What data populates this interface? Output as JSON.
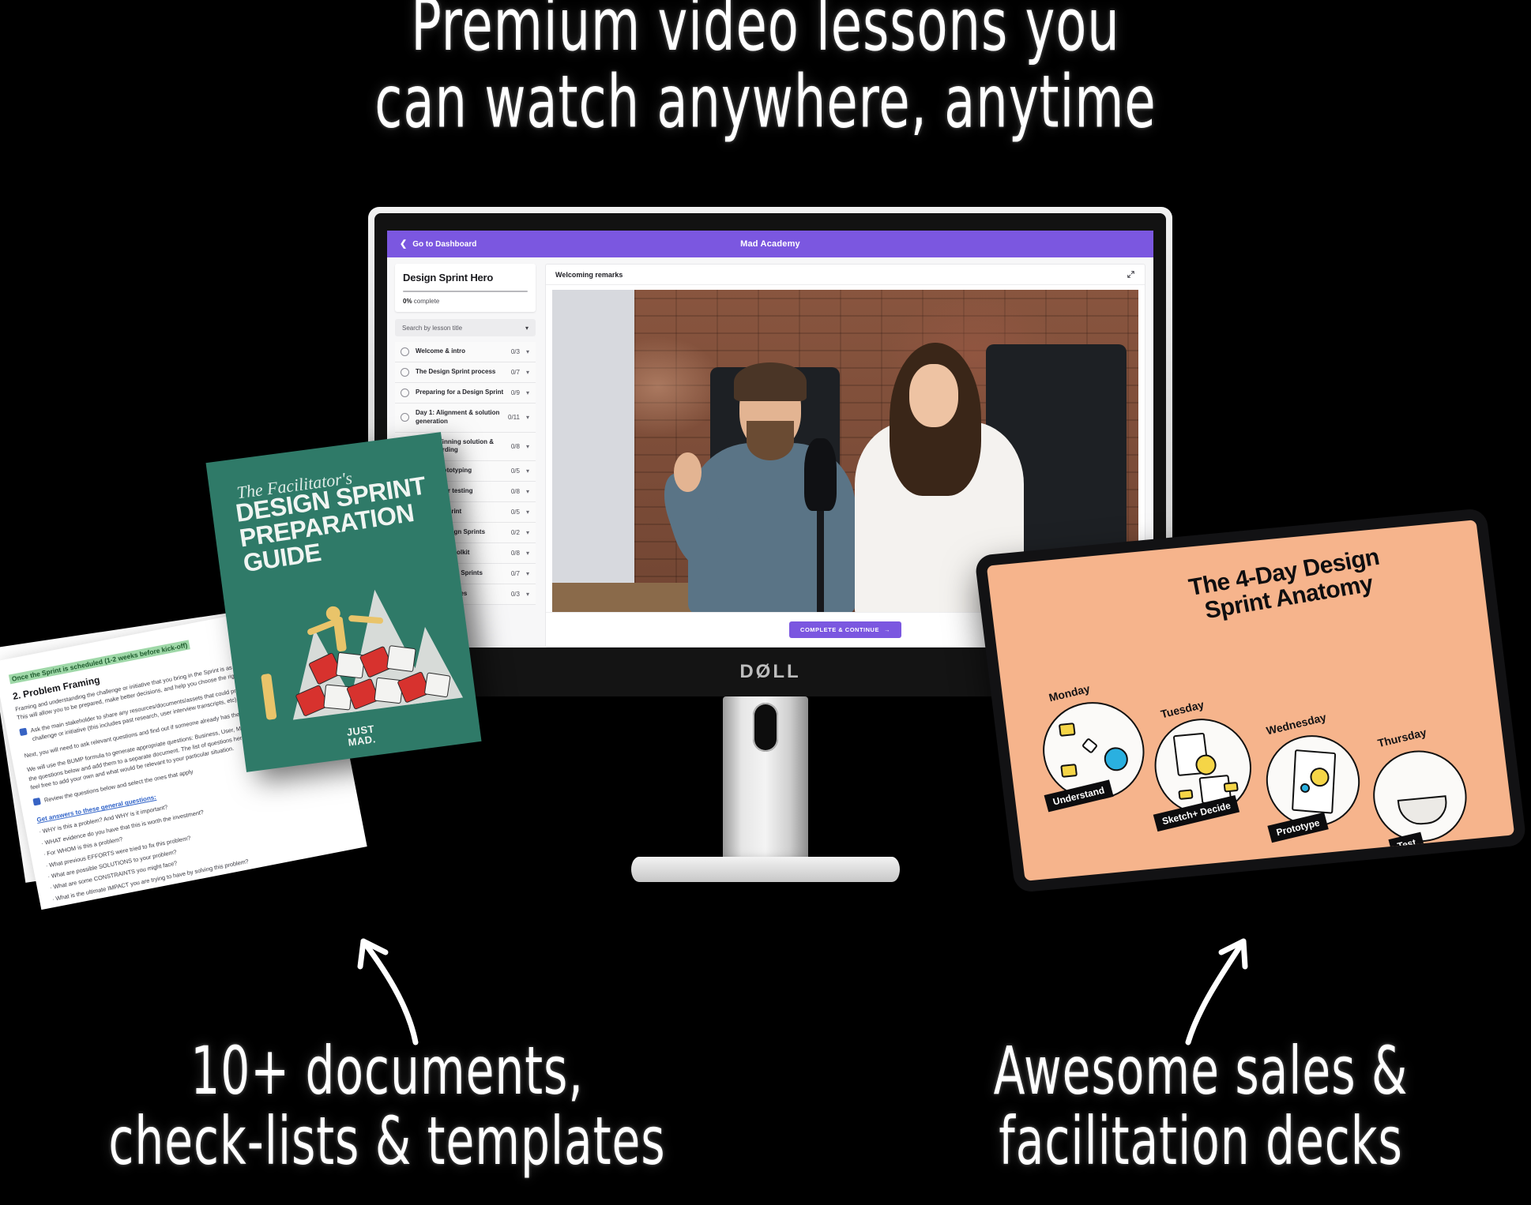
{
  "headline": {
    "line1": "Premium video lessons you",
    "line2": "can watch anywhere, anytime"
  },
  "captions": {
    "left_line1": "10+ documents,",
    "left_line2": "check-lists & templates",
    "right_line1": "Awesome sales &",
    "right_line2": "facilitation decks"
  },
  "monitor": {
    "brand_logo": "DØLL"
  },
  "app": {
    "topbar": {
      "back_label": "Go to Dashboard",
      "brand": "Mad Academy",
      "accent_color": "#7b57e0"
    },
    "sidebar": {
      "course_title": "Design Sprint Hero",
      "progress_percent": "0%",
      "progress_suffix": " complete",
      "search_placeholder": "Search by lesson title",
      "lessons": [
        {
          "name": "Welcome & intro",
          "count": "0/3"
        },
        {
          "name": "The Design Sprint process",
          "count": "0/7"
        },
        {
          "name": "Preparing for a Design Sprint",
          "count": "0/9"
        },
        {
          "name": "Day 1: Alignment & solution generation",
          "count": "0/11"
        },
        {
          "name": "Day 2: Winning solution & storyboarding",
          "count": "0/8"
        },
        {
          "name": "Day 3: Prototyping",
          "count": "0/5"
        },
        {
          "name": "Day 4: User testing",
          "count": "0/8"
        },
        {
          "name": "After the Sprint",
          "count": "0/5"
        },
        {
          "name": "Remote Design Sprints",
          "count": "0/2"
        },
        {
          "name": "Facilitation toolkit",
          "count": "0/8"
        },
        {
          "name": "Selling Design Sprints",
          "count": "0/7"
        },
        {
          "name": "Bonus resources",
          "count": "0/3"
        }
      ]
    },
    "main": {
      "lesson_title": "Welcoming remarks",
      "expand_icon": "expand-arrows-icon",
      "complete_button": "COMPLETE & CONTINUE",
      "complete_button_arrow": "→"
    }
  },
  "book": {
    "kicker": "The Facilitator's",
    "title_line1": "DESIGN SPRINT",
    "title_line2": "PREPARATION",
    "title_line3": "GUIDE",
    "brand_line1": "JUST",
    "brand_line2": "MAD.",
    "cover_color": "#2f7a68"
  },
  "document": {
    "highlight": "Once the Sprint is scheduled (1-2 weeks before kick-off)",
    "heading": "2. Problem Framing",
    "paragraph1": "Framing and understanding the challenge or initiative that you bring in the Sprint is as important as the Sprint itself. This will allow you to be prepared, make better decisions, and help you choose the right people in your Sprint team.",
    "note1": "Ask the main stakeholder to share any resources/documents/assets that could provide you with insight on the challenge or initiative (this includes past research, user interview transcripts, etc)",
    "paragraph2": "Next, you will need to ask relevant questions and find out if someone already has the answers.",
    "paragraph3": "We will use the BUMP formula to generate appropriate questions: Business, User, Market, and Product. Simply select the questions below and add them to a separate document. The list of questions here are the most common ones, but feel free to add your own and what would be relevant to your particular situation.",
    "note2": "Review the questions below and select the ones that apply",
    "link": "Get answers to these general questions:",
    "questions": [
      "WHY is this a problem? And WHY is it important?",
      "WHAT evidence do you have that this is worth the investment?",
      "For WHOM is this a problem?",
      "What previous EFFORTS were tried to fix this problem?",
      "What are possible SOLUTIONS to your problem?",
      "What are some CONSTRAINTS you might face?",
      "What is the ultimate IMPACT you are trying to have by solving this problem?"
    ]
  },
  "tablet": {
    "slide_title_line1": "The 4-Day Design",
    "slide_title_line2": "Sprint Anatomy",
    "background_color": "#f6b48c",
    "days": [
      {
        "day": "Monday",
        "stage": "Understand",
        "icon": "flow-arrows-icon"
      },
      {
        "day": "Tuesday",
        "stage": "Sketch+ Decide",
        "icon": "sticky-notes-icon"
      },
      {
        "day": "Wednesday",
        "stage": "Prototype",
        "icon": "phone-mockup-icon"
      },
      {
        "day": "Thursday",
        "stage": "Test",
        "icon": "speech-bubble-icon"
      }
    ]
  }
}
